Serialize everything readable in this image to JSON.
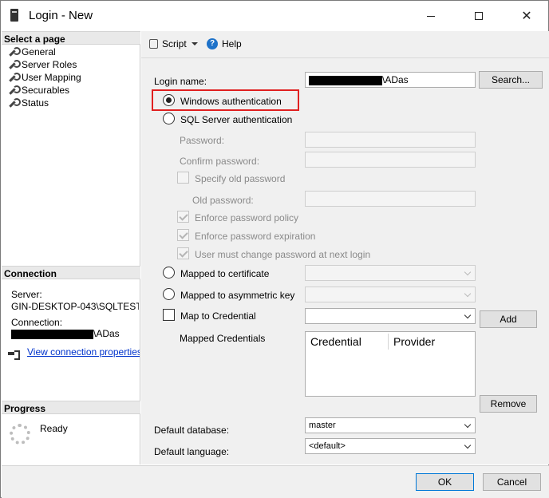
{
  "window": {
    "title": "Login - New"
  },
  "left": {
    "select_page_title": "Select a page",
    "pages": [
      "General",
      "Server Roles",
      "User Mapping",
      "Securables",
      "Status"
    ],
    "connection_title": "Connection",
    "server_label": "Server:",
    "server_value": "GIN-DESKTOP-043\\SQLTEST",
    "connection_label": "Connection:",
    "connection_suffix": "\\ADas",
    "view_link": "View connection properties",
    "progress_title": "Progress",
    "progress_status": "Ready"
  },
  "toolbar": {
    "script_label": "Script",
    "help_label": "Help"
  },
  "form": {
    "login_name_label": "Login name:",
    "login_name_suffix": "\\ADas",
    "search_button": "Search...",
    "windows_auth": "Windows authentication",
    "sql_auth": "SQL Server authentication",
    "password_label": "Password:",
    "confirm_password_label": "Confirm password:",
    "specify_old_password": "Specify old password",
    "old_password_label": "Old password:",
    "enforce_policy": "Enforce password policy",
    "enforce_expiration": "Enforce password expiration",
    "must_change": "User must change password at next login",
    "mapped_cert": "Mapped to certificate",
    "mapped_asym": "Mapped to asymmetric key",
    "map_credential": "Map to Credential",
    "add_button": "Add",
    "mapped_credentials_label": "Mapped Credentials",
    "grid_headers": [
      "Credential",
      "Provider"
    ],
    "remove_button": "Remove",
    "default_database_label": "Default database:",
    "default_database_value": "master",
    "default_language_label": "Default language:",
    "default_language_value": "<default>"
  },
  "footer": {
    "ok_button": "OK",
    "cancel_button": "Cancel"
  }
}
